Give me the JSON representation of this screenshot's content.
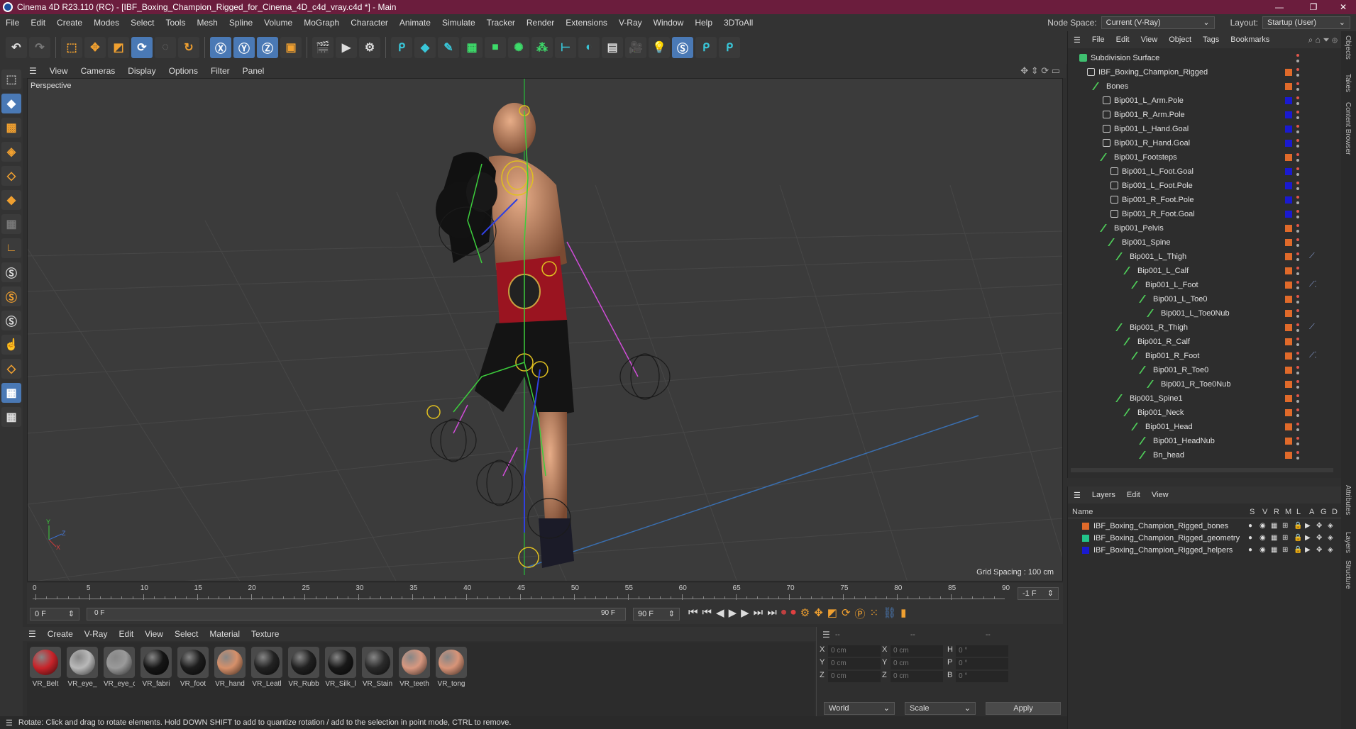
{
  "window": {
    "title": "Cinema 4D R23.110 (RC) - [IBF_Boxing_Champion_Rigged_for_Cinema_4D_c4d_vray.c4d *] - Main",
    "controls": [
      "—",
      "❐",
      "✕"
    ]
  },
  "menu": [
    "File",
    "Edit",
    "Create",
    "Modes",
    "Select",
    "Tools",
    "Mesh",
    "Spline",
    "Volume",
    "MoGraph",
    "Character",
    "Animate",
    "Simulate",
    "Tracker",
    "Render",
    "Extensions",
    "V-Ray",
    "Window",
    "Help",
    "3DToAll"
  ],
  "nodespace": {
    "label": "Node Space:",
    "value": "Current (V-Ray)"
  },
  "layout": {
    "label": "Layout:",
    "value": "Startup (User)"
  },
  "viewport": {
    "menu": [
      "View",
      "Cameras",
      "Display",
      "Options",
      "Filter",
      "Panel"
    ],
    "name": "Perspective",
    "grid_spacing": "Grid Spacing : 100 cm",
    "axes": {
      "y": "Y",
      "z": "Z",
      "x": "X"
    }
  },
  "timeline": {
    "ticks": [
      "0",
      "5",
      "10",
      "15",
      "20",
      "25",
      "30",
      "35",
      "40",
      "45",
      "50",
      "55",
      "60",
      "65",
      "70",
      "75",
      "80",
      "85",
      "90"
    ],
    "current_frame": "-1 F"
  },
  "playback": {
    "start": "0 F",
    "range_start": "0 F",
    "range_end": "90 F",
    "end": "90 F"
  },
  "materials": {
    "menu": [
      "Create",
      "V-Ray",
      "Edit",
      "View",
      "Select",
      "Material",
      "Texture"
    ],
    "items": [
      {
        "name": "VR_Belt",
        "color": "#c8242a"
      },
      {
        "name": "VR_eye_",
        "color": "#b9b9b9"
      },
      {
        "name": "VR_eye_c",
        "color": "#9a9a9a"
      },
      {
        "name": "VR_fabri",
        "color": "#151515"
      },
      {
        "name": "VR_foot",
        "color": "#1c1c1c"
      },
      {
        "name": "VR_hand",
        "color": "#d6906a"
      },
      {
        "name": "VR_Leatl",
        "color": "#222222"
      },
      {
        "name": "VR_Rubb",
        "color": "#202020"
      },
      {
        "name": "VR_Silk_l",
        "color": "#181818"
      },
      {
        "name": "VR_Stain",
        "color": "#2a2a2a"
      },
      {
        "name": "VR_teeth",
        "color": "#d89880"
      },
      {
        "name": "VR_tong",
        "color": "#d89478"
      }
    ]
  },
  "coordinates": {
    "headers": [
      "--",
      "--",
      "--"
    ],
    "rows": [
      {
        "a": "X",
        "av": "0 cm",
        "b": "X",
        "bv": "0 cm",
        "c": "H",
        "cv": "0 °"
      },
      {
        "a": "Y",
        "av": "0 cm",
        "b": "Y",
        "bv": "0 cm",
        "c": "P",
        "cv": "0 °"
      },
      {
        "a": "Z",
        "av": "0 cm",
        "b": "Z",
        "bv": "0 cm",
        "c": "B",
        "cv": "0 °"
      }
    ],
    "mode": "World",
    "scale": "Scale",
    "apply": "Apply"
  },
  "status": "Rotate: Click and drag to rotate elements. Hold DOWN SHIFT to add to quantize rotation / add to the selection in point mode, CTRL to remove.",
  "objects": {
    "menu": [
      "File",
      "Edit",
      "View",
      "Object",
      "Tags",
      "Bookmarks"
    ],
    "tree": [
      {
        "label": "Subdivision Surface",
        "depth": 0,
        "icon": "subdiv",
        "color": ""
      },
      {
        "label": "IBF_Boxing_Champion_Rigged",
        "depth": 1,
        "icon": "null",
        "color": "#e06a2a"
      },
      {
        "label": "Bones",
        "depth": 2,
        "icon": "bone",
        "color": "#e06a2a"
      },
      {
        "label": "Bip001_L_Arm.Pole",
        "depth": 3,
        "icon": "null",
        "color": "#1a1ad0"
      },
      {
        "label": "Bip001_R_Arm.Pole",
        "depth": 3,
        "icon": "null",
        "color": "#1a1ad0"
      },
      {
        "label": "Bip001_L_Hand.Goal",
        "depth": 3,
        "icon": "null",
        "color": "#1a1ad0"
      },
      {
        "label": "Bip001_R_Hand.Goal",
        "depth": 3,
        "icon": "null",
        "color": "#1a1ad0"
      },
      {
        "label": "Bip001_Footsteps",
        "depth": 3,
        "icon": "bone",
        "color": "#e06a2a"
      },
      {
        "label": "Bip001_L_Foot.Goal",
        "depth": 4,
        "icon": "null",
        "color": "#1a1ad0"
      },
      {
        "label": "Bip001_L_Foot.Pole",
        "depth": 4,
        "icon": "null",
        "color": "#1a1ad0"
      },
      {
        "label": "Bip001_R_Foot.Pole",
        "depth": 4,
        "icon": "null",
        "color": "#1a1ad0"
      },
      {
        "label": "Bip001_R_Foot.Goal",
        "depth": 4,
        "icon": "null",
        "color": "#1a1ad0"
      },
      {
        "label": "Bip001_Pelvis",
        "depth": 3,
        "icon": "bone",
        "color": "#e06a2a"
      },
      {
        "label": "Bip001_Spine",
        "depth": 4,
        "icon": "bone",
        "color": "#e06a2a"
      },
      {
        "label": "Bip001_L_Thigh",
        "depth": 5,
        "icon": "bone",
        "color": "#e06a2a",
        "tag": "ik"
      },
      {
        "label": "Bip001_L_Calf",
        "depth": 6,
        "icon": "bone",
        "color": "#e06a2a"
      },
      {
        "label": "Bip001_L_Foot",
        "depth": 7,
        "icon": "bone",
        "color": "#e06a2a",
        "tag": "ik2"
      },
      {
        "label": "Bip001_L_Toe0",
        "depth": 8,
        "icon": "bone",
        "color": "#e06a2a"
      },
      {
        "label": "Bip001_L_Toe0Nub",
        "depth": 9,
        "icon": "bone",
        "color": "#e06a2a"
      },
      {
        "label": "Bip001_R_Thigh",
        "depth": 5,
        "icon": "bone",
        "color": "#e06a2a",
        "tag": "ik"
      },
      {
        "label": "Bip001_R_Calf",
        "depth": 6,
        "icon": "bone",
        "color": "#e06a2a"
      },
      {
        "label": "Bip001_R_Foot",
        "depth": 7,
        "icon": "bone",
        "color": "#e06a2a",
        "tag": "ik2"
      },
      {
        "label": "Bip001_R_Toe0",
        "depth": 8,
        "icon": "bone",
        "color": "#e06a2a"
      },
      {
        "label": "Bip001_R_Toe0Nub",
        "depth": 9,
        "icon": "bone",
        "color": "#e06a2a"
      },
      {
        "label": "Bip001_Spine1",
        "depth": 5,
        "icon": "bone",
        "color": "#e06a2a"
      },
      {
        "label": "Bip001_Neck",
        "depth": 6,
        "icon": "bone",
        "color": "#e06a2a"
      },
      {
        "label": "Bip001_Head",
        "depth": 7,
        "icon": "bone",
        "color": "#e06a2a"
      },
      {
        "label": "Bip001_HeadNub",
        "depth": 8,
        "icon": "bone",
        "color": "#e06a2a"
      },
      {
        "label": "Bn_head",
        "depth": 8,
        "icon": "bone",
        "color": "#e06a2a"
      },
      {
        "label": "Bn_head",
        "depth": 9,
        "icon": "bone",
        "color": "#e06a2a"
      }
    ]
  },
  "layers": {
    "menu": [
      "Layers",
      "Edit",
      "View"
    ],
    "header": {
      "name": "Name",
      "cols": [
        "S",
        "V",
        "R",
        "M",
        "L",
        "A",
        "G",
        "D"
      ]
    },
    "items": [
      {
        "name": "IBF_Boxing_Champion_Rigged_bones",
        "color": "#e06a2a"
      },
      {
        "name": "IBF_Boxing_Champion_Rigged_geometry",
        "color": "#22c48a"
      },
      {
        "name": "IBF_Boxing_Champion_Rigged_helpers",
        "color": "#1a1ad0"
      }
    ]
  },
  "side_tabs": [
    "Objects",
    "Takes",
    "Content Browser",
    "Attributes",
    "Layers",
    "Structure"
  ]
}
